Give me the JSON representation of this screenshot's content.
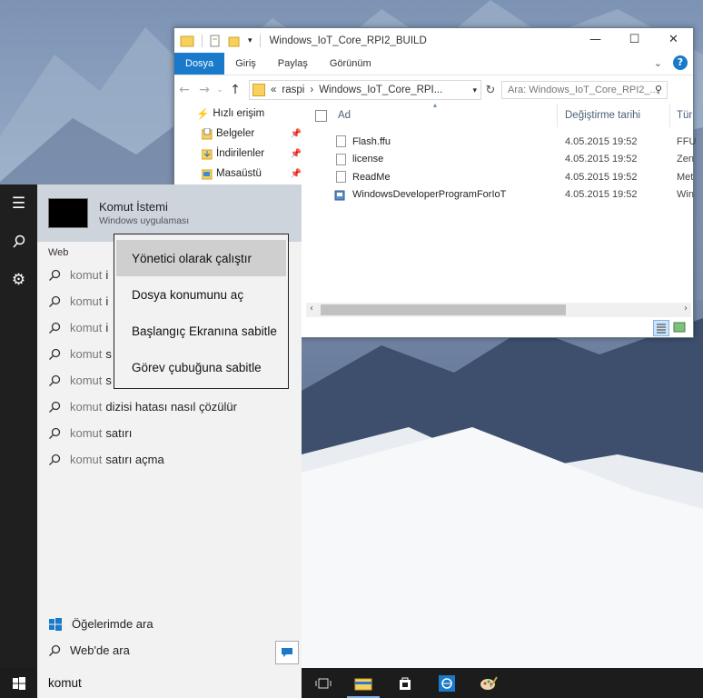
{
  "explorer": {
    "title": "Windows_IoT_Core_RPI2_BUILD",
    "ribbon_tabs": [
      "Dosya",
      "Giriş",
      "Paylaş",
      "Görünüm"
    ],
    "address": {
      "prefix": "«",
      "parts": [
        "raspi",
        "Windows_IoT_Core_RPI..."
      ]
    },
    "search_placeholder": "Ara: Windows_IoT_Core_RPI2_...",
    "nav": [
      {
        "label": "Hızlı erişim",
        "icon": "star-icon"
      },
      {
        "label": "Belgeler",
        "icon": "documents-icon",
        "pinned": true
      },
      {
        "label": "İndirilenler",
        "icon": "downloads-icon",
        "pinned": true
      },
      {
        "label": "Masaüstü",
        "icon": "desktop-icon",
        "pinned": true
      }
    ],
    "columns": [
      "Ad",
      "Değiştirme tarihi",
      "Tür"
    ],
    "files": [
      {
        "name": "Flash.ffu",
        "date": "4.05.2015 19:52",
        "type": "FFU"
      },
      {
        "name": "license",
        "date": "4.05.2015 19:52",
        "type": "Zen"
      },
      {
        "name": "ReadMe",
        "date": "4.05.2015 19:52",
        "type": "Met"
      },
      {
        "name": "WindowsDeveloperProgramForIoT",
        "date": "4.05.2015 19:52",
        "type": "Win"
      }
    ]
  },
  "start": {
    "best_match": {
      "title": "Komut İstemi",
      "subtitle": "Windows uygulaması"
    },
    "web_header": "Web",
    "suggestions": [
      {
        "query": "komut",
        "rest": " i"
      },
      {
        "query": "komut",
        "rest": " i"
      },
      {
        "query": "komut",
        "rest": " i"
      },
      {
        "query": "komut",
        "rest": " s"
      },
      {
        "query": "komut",
        "rest": " s"
      },
      {
        "query": "komut",
        "rest": " dizisi hatası nasıl çözülür"
      },
      {
        "query": "komut",
        "rest": " satırı"
      },
      {
        "query": "komut",
        "rest": " satırı açma"
      }
    ],
    "my_stuff": "Öğelerimde ara",
    "web_search": "Web'de ara",
    "search_text": "komut"
  },
  "context_menu": [
    "Yönetici olarak çalıştır",
    "Dosya konumunu aç",
    "Başlangıç Ekranına sabitle",
    "Görev çubuğuna sabitle"
  ],
  "colors": {
    "accent": "#1979ca",
    "taskbar": "#1c1c1c",
    "start_panel": "#f2f2f2"
  }
}
